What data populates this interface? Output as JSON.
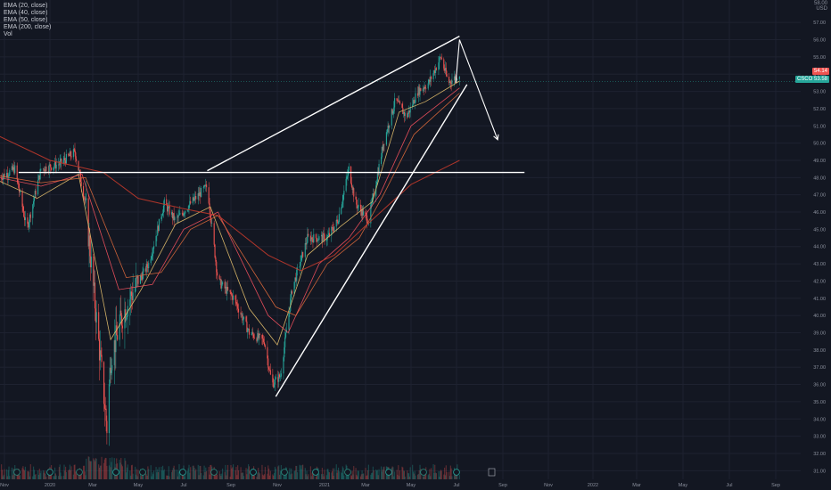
{
  "legend": {
    "items": [
      "EMA (20, close)",
      "EMA (40, close)",
      "EMA (50, close)",
      "EMA (200, close)",
      "Vol"
    ]
  },
  "price_axis": {
    "top_partial_label": "58.00",
    "currency_label": "USD",
    "last_price": "54.14",
    "symbol_tag": "CSCO",
    "symbol_price": "53.58"
  },
  "colors": {
    "background": "#131722",
    "grid": "#1e2230",
    "candle_up": "#26a69a",
    "candle_down": "#ef5350",
    "ema20": "#e8c26e",
    "ema40": "#f7525f",
    "ema50": "#e06a3c",
    "ema200": "#c0392b",
    "drawing": "#ffffff",
    "last_price_tag": "#ef5350",
    "symbol_tag": "#26a69a"
  },
  "chart_data": {
    "type": "candlestick",
    "title": "",
    "y_axis": {
      "ticks": [
        "57.00",
        "56.00",
        "55.00",
        "54.00",
        "53.00",
        "52.00",
        "51.00",
        "50.00",
        "49.00",
        "48.00",
        "47.00",
        "46.00",
        "45.00",
        "44.00",
        "43.00",
        "42.00",
        "41.00",
        "40.00",
        "39.00",
        "38.00",
        "37.00",
        "36.00",
        "35.00",
        "34.00",
        "33.00",
        "32.00",
        "31.00"
      ],
      "range": [
        30.5,
        58.3
      ]
    },
    "x_axis": {
      "ticks": [
        "Nov",
        "2020",
        "Mar",
        "May",
        "Jul",
        "Sep",
        "Nov",
        "2021",
        "Mar",
        "May",
        "Jul",
        "Sep",
        "Nov",
        "2022",
        "Mar",
        "May",
        "Jul",
        "Sep"
      ],
      "range_months": [
        "2019-10",
        "2022-10"
      ]
    },
    "price_series": {
      "name": "Price",
      "points": [
        [
          "2019-10-25",
          48.0
        ],
        [
          "2019-11-15",
          48.5
        ],
        [
          "2019-12-01",
          45.0
        ],
        [
          "2019-12-20",
          48.5
        ],
        [
          "2020-01-15",
          48.8
        ],
        [
          "2020-02-05",
          49.5
        ],
        [
          "2020-02-20",
          46.5
        ],
        [
          "2020-03-10",
          38.0
        ],
        [
          "2020-03-20",
          33.5
        ],
        [
          "2020-03-25",
          37.5
        ],
        [
          "2020-04-10",
          40.0
        ],
        [
          "2020-04-25",
          41.5
        ],
        [
          "2020-05-15",
          43.0
        ],
        [
          "2020-06-05",
          46.5
        ],
        [
          "2020-06-20",
          45.5
        ],
        [
          "2020-07-10",
          46.5
        ],
        [
          "2020-08-01",
          47.5
        ],
        [
          "2020-08-15",
          42.0
        ],
        [
          "2020-09-05",
          41.0
        ],
        [
          "2020-09-25",
          39.0
        ],
        [
          "2020-10-15",
          38.5
        ],
        [
          "2020-10-25",
          36.0
        ],
        [
          "2020-11-05",
          36.5
        ],
        [
          "2020-11-20",
          41.5
        ],
        [
          "2020-12-10",
          44.5
        ],
        [
          "2021-01-05",
          44.5
        ],
        [
          "2021-01-20",
          45.5
        ],
        [
          "2021-02-05",
          48.5
        ],
        [
          "2021-02-15",
          46.5
        ],
        [
          "2021-03-05",
          45.5
        ],
        [
          "2021-03-25",
          50.0
        ],
        [
          "2021-04-10",
          52.5
        ],
        [
          "2021-04-25",
          51.5
        ],
        [
          "2021-05-10",
          53.0
        ],
        [
          "2021-05-25",
          53.5
        ],
        [
          "2021-06-10",
          55.0
        ],
        [
          "2021-06-20",
          53.5
        ],
        [
          "2021-07-05",
          54.0
        ]
      ]
    },
    "ema_series": [
      {
        "name": "EMA (20, close)",
        "points": [
          [
            "2019-10-25",
            47.8
          ],
          [
            "2019-12-15",
            46.8
          ],
          [
            "2020-02-10",
            48.2
          ],
          [
            "2020-03-25",
            38.6
          ],
          [
            "2020-05-05",
            41.5
          ],
          [
            "2020-06-20",
            45.3
          ],
          [
            "2020-08-05",
            46.3
          ],
          [
            "2020-09-25",
            40.4
          ],
          [
            "2020-11-01",
            38.3
          ],
          [
            "2020-12-10",
            43.5
          ],
          [
            "2021-01-25",
            45.2
          ],
          [
            "2021-03-10",
            46.6
          ],
          [
            "2021-04-15",
            51.8
          ],
          [
            "2021-05-20",
            52.4
          ],
          [
            "2021-07-05",
            53.6
          ]
        ]
      },
      {
        "name": "EMA (40, close)",
        "points": [
          [
            "2019-10-25",
            48.0
          ],
          [
            "2019-12-20",
            47.5
          ],
          [
            "2020-02-15",
            48.2
          ],
          [
            "2020-04-05",
            41.5
          ],
          [
            "2020-05-20",
            41.8
          ],
          [
            "2020-07-01",
            45.0
          ],
          [
            "2020-08-15",
            46.0
          ],
          [
            "2020-10-20",
            40.0
          ],
          [
            "2020-11-15",
            39.0
          ],
          [
            "2020-12-25",
            43.0
          ],
          [
            "2021-02-05",
            44.5
          ],
          [
            "2021-03-20",
            47.0
          ],
          [
            "2021-05-01",
            51.0
          ],
          [
            "2021-07-05",
            53.2
          ]
        ]
      },
      {
        "name": "EMA (50, close)",
        "points": [
          [
            "2019-10-25",
            48.1
          ],
          [
            "2019-12-20",
            47.7
          ],
          [
            "2020-02-20",
            48.0
          ],
          [
            "2020-04-15",
            42.2
          ],
          [
            "2020-06-01",
            42.5
          ],
          [
            "2020-07-10",
            45.0
          ],
          [
            "2020-08-15",
            45.8
          ],
          [
            "2020-10-30",
            40.5
          ],
          [
            "2020-11-25",
            40.0
          ],
          [
            "2021-01-05",
            43.0
          ],
          [
            "2021-02-20",
            44.5
          ],
          [
            "2021-03-25",
            47.0
          ],
          [
            "2021-05-05",
            50.5
          ],
          [
            "2021-07-05",
            52.9
          ]
        ]
      },
      {
        "name": "EMA (200, close)",
        "points": [
          [
            "2019-10-25",
            50.4
          ],
          [
            "2020-01-01",
            49.0
          ],
          [
            "2020-03-15",
            48.3
          ],
          [
            "2020-05-01",
            46.8
          ],
          [
            "2020-07-01",
            46.2
          ],
          [
            "2020-08-15",
            45.8
          ],
          [
            "2020-10-20",
            43.5
          ],
          [
            "2020-12-01",
            42.6
          ],
          [
            "2021-01-15",
            43.5
          ],
          [
            "2021-03-01",
            45.2
          ],
          [
            "2021-05-01",
            47.6
          ],
          [
            "2021-07-05",
            49.0
          ]
        ]
      }
    ],
    "annotations": [
      {
        "type": "horizontal_line",
        "y": 48.3,
        "from": "2019-11-20",
        "to": "2021-09-30"
      },
      {
        "type": "trendline",
        "from": [
          "2020-08-01",
          48.4
        ],
        "to": [
          "2021-07-05",
          56.2
        ]
      },
      {
        "type": "trendline",
        "from": [
          "2020-10-30",
          35.3
        ],
        "to": [
          "2021-07-15",
          53.4
        ]
      },
      {
        "type": "arrow",
        "from": [
          "2021-06-30",
          53.5
        ],
        "via": [
          "2021-07-05",
          56.0
        ],
        "to": [
          "2021-08-25",
          50.2
        ]
      }
    ],
    "grid": true
  }
}
